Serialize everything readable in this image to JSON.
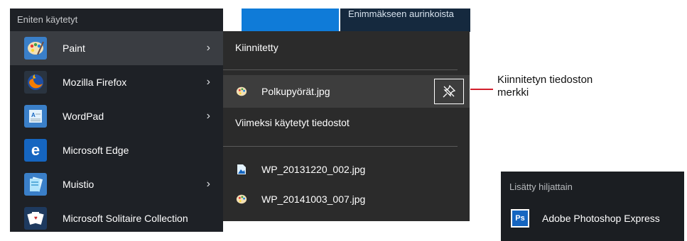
{
  "start_menu": {
    "heading": "Eniten käytetyt",
    "apps": [
      {
        "label": "Paint",
        "icon": "paint-palette-icon",
        "has_submenu": true,
        "selected": true
      },
      {
        "label": "Mozilla Firefox",
        "icon": "firefox-icon",
        "has_submenu": true
      },
      {
        "label": "WordPad",
        "icon": "wordpad-icon",
        "has_submenu": true
      },
      {
        "label": "Microsoft Edge",
        "icon": "edge-icon",
        "has_submenu": false
      },
      {
        "label": "Muistio",
        "icon": "notepad-icon",
        "has_submenu": true
      },
      {
        "label": "Microsoft Solitaire Collection",
        "icon": "solitaire-cards-icon",
        "has_submenu": false
      }
    ],
    "chevron": "›"
  },
  "tiles": {
    "weather_text": "Enimmäkseen aurinkoista"
  },
  "jump_list": {
    "pinned_heading": "Kiinnitetty",
    "pinned_items": [
      {
        "label": "Polkupyörät.jpg",
        "icon": "paint-palette-icon"
      }
    ],
    "recent_heading": "Viimeksi käytetyt tiedostot",
    "recent_items": [
      {
        "label": "WP_20131220_002.jpg",
        "icon": "image-file-icon"
      },
      {
        "label": "WP_20141003_007.jpg",
        "icon": "paint-palette-icon"
      }
    ]
  },
  "callout": {
    "text_line1": "Kiinnitetyn tiedoston",
    "text_line2": "merkki",
    "line_color": "#d21f2c"
  },
  "recently_added": {
    "heading": "Lisätty hiljattain",
    "item_label": "Adobe Photoshop Express",
    "icon_text": "Ps"
  },
  "colors": {
    "menu_bg": "#1e2126",
    "jump_list_bg": "#2b2b2b",
    "tile_blue": "#0f7bd8"
  }
}
